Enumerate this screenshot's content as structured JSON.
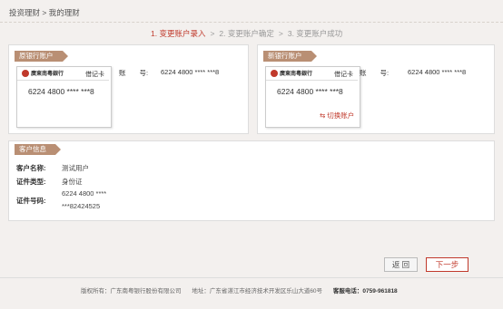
{
  "breadcrumb": {
    "text": "投资理财 > 我的理财"
  },
  "steps": [
    {
      "label": "1. 变更账户录入"
    },
    {
      "label": "2. 变更账户确定"
    },
    {
      "label": "3. 变更账户成功"
    }
  ],
  "step_sep": ">",
  "old_account": {
    "tag": "原银行账户",
    "bank_name": "廣東南粵銀行",
    "card_type": "借记卡",
    "card_number": "6224 4800 **** ***8",
    "label": "账　　号:",
    "number": "6224 4800 **** ***8"
  },
  "new_account": {
    "tag": "新银行账户",
    "bank_name": "廣東南粵銀行",
    "card_type": "借记卡",
    "card_number": "6224 4800 **** ***8",
    "label": "账　　号:",
    "number": "6224 4800 **** ***8",
    "switch_label": "切换账户"
  },
  "customer": {
    "tag": "客户信息",
    "name_label": "客户名称:",
    "name_value": "测试用户",
    "id_type_label": "证件类型:",
    "id_type_value": "身份证",
    "id_no_label": "证件号码:",
    "id_no_line1": "6224 4800 ****",
    "id_no_line2": "***82424525"
  },
  "buttons": {
    "back": "返 回",
    "next": "下一步"
  },
  "footer": {
    "copyright": "版权所有：广东南粤银行股份有限公司",
    "address": "地址：广东省湛江市经济技术开发区乐山大道60号",
    "phone_label": "客服电话：",
    "phone": "0759-961818"
  },
  "colors": {
    "accent": "#c0392b",
    "tag": "#b98f74"
  }
}
